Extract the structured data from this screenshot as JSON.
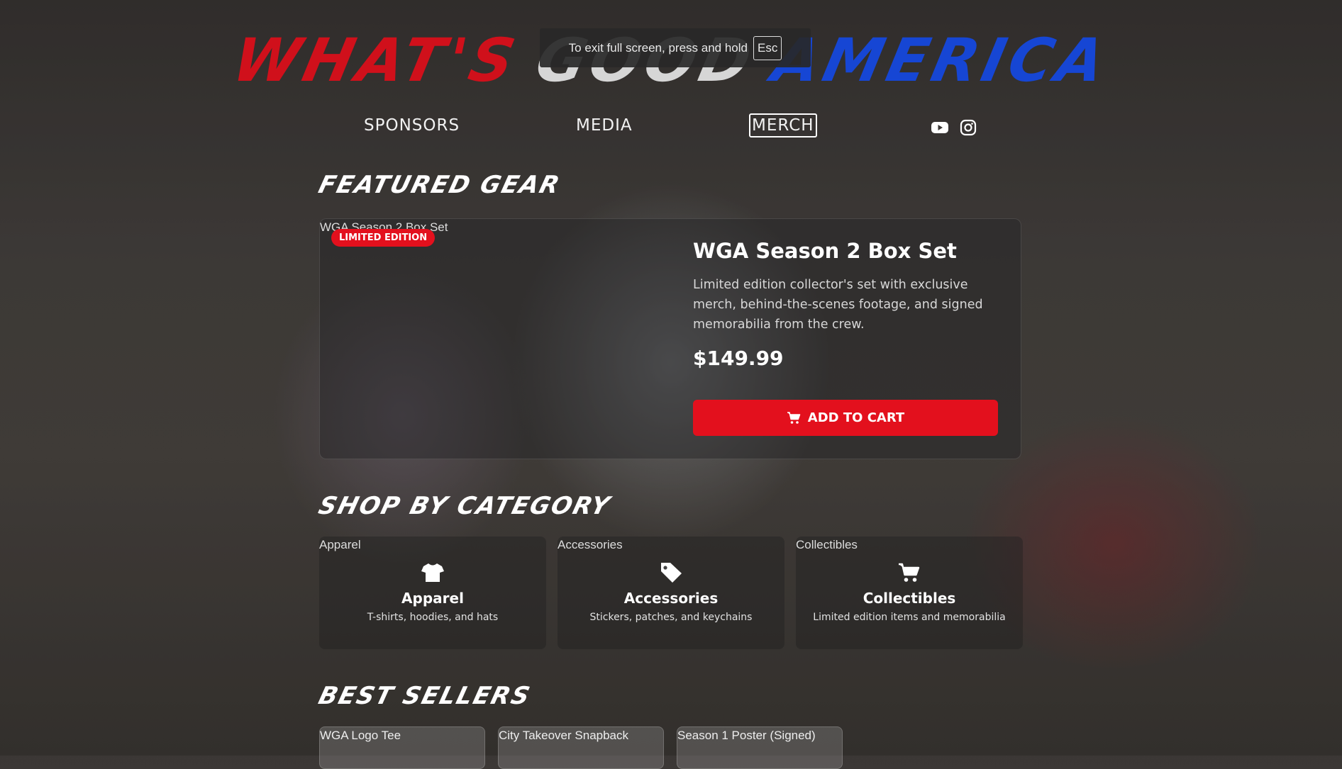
{
  "fullscreen_notice": {
    "text": "To exit full screen, press and hold",
    "key": "Esc"
  },
  "hero": {
    "word1": "WHAT'S",
    "word2": "GOOD",
    "word3": "AMERICA"
  },
  "nav": {
    "sponsors": "SPONSORS",
    "media": "MEDIA",
    "merch": "MERCH",
    "active": "MERCH"
  },
  "social": {
    "youtube_icon": "youtube-icon",
    "instagram_icon": "instagram-icon"
  },
  "sections": {
    "featured": "FEATURED GEAR",
    "categories": "SHOP BY CATEGORY",
    "best_sellers": "BEST SELLERS"
  },
  "featured_product": {
    "image_alt": "WGA Season 2 Box Set",
    "badge": "LIMITED EDITION",
    "name": "WGA Season 2 Box Set",
    "description": "Limited edition collector's set with exclusive merch, behind-the-scenes footage, and signed memorabilia from the crew.",
    "price": "$149.99",
    "cta": "ADD TO CART"
  },
  "categories": [
    {
      "image_alt": "Apparel",
      "icon": "tshirt-icon",
      "name": "Apparel",
      "desc": "T-shirts, hoodies, and hats"
    },
    {
      "image_alt": "Accessories",
      "icon": "tag-icon",
      "name": "Accessories",
      "desc": "Stickers, patches, and keychains"
    },
    {
      "image_alt": "Collectibles",
      "icon": "cart-icon",
      "name": "Collectibles",
      "desc": "Limited edition items and memorabilia"
    }
  ],
  "best_sellers": [
    {
      "image_alt": "WGA Logo Tee"
    },
    {
      "image_alt": "City Takeover Snapback"
    },
    {
      "image_alt": "Season 1 Poster (Signed)"
    }
  ],
  "colors": {
    "accent_red": "#e3101d",
    "hero_red": "#d0101b",
    "hero_blue": "#1646d4"
  }
}
